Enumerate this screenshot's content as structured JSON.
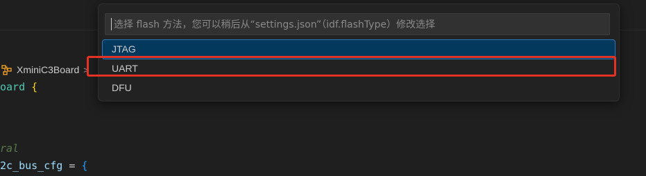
{
  "editor": {
    "breadcrumb": {
      "symbol": "XminiC3Board",
      "chevron": ">"
    },
    "code_lines": [
      {
        "segments": [
          {
            "t": "oard ",
            "c": "tok-type"
          },
          {
            "t": "{",
            "c": "tok-brace"
          }
        ]
      },
      {
        "segments": [
          {
            "t": "ral",
            "c": "tok-comment"
          }
        ]
      },
      {
        "segments": [
          {
            "t": "2c_bus_cfg",
            "c": "tok-var"
          },
          {
            "t": " = ",
            "c": ""
          },
          {
            "t": "{",
            "c": "tok-brace2"
          }
        ]
      }
    ]
  },
  "quick_pick": {
    "placeholder": "选择 flash 方法，您可以稍后从“settings.json”（idf.flashType）修改选择",
    "items": [
      {
        "label": "JTAG",
        "selected": true
      },
      {
        "label": "UART",
        "selected": false
      },
      {
        "label": "DFU",
        "selected": false
      }
    ]
  },
  "colors": {
    "highlight_box": "#e53224",
    "selection_bg": "#04395e",
    "struct_icon": "#ee9d28"
  },
  "icons": {
    "breadcrumb_symbol": "struct-icon",
    "breadcrumb_separator": "chevron-right-icon"
  }
}
